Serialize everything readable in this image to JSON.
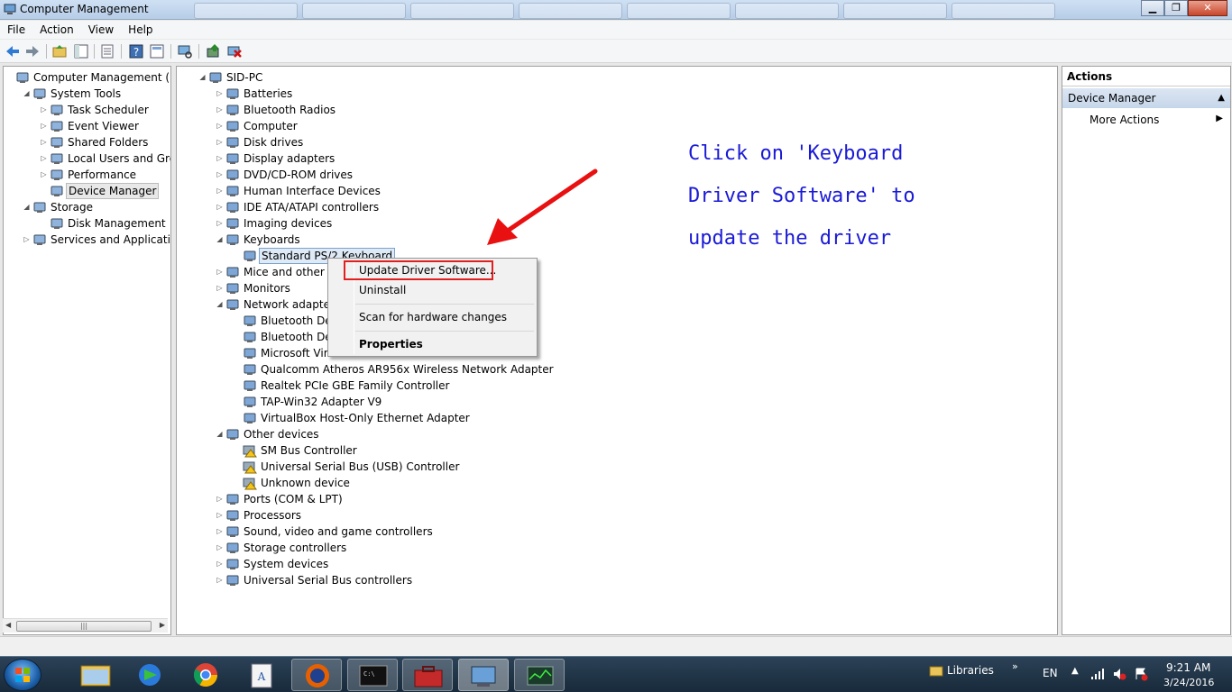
{
  "window": {
    "title": "Computer Management"
  },
  "menu": [
    "File",
    "Action",
    "View",
    "Help"
  ],
  "left_tree": [
    {
      "label": "Computer Management (Local",
      "level": 0,
      "expander": "",
      "icon": "computer-management-icon"
    },
    {
      "label": "System Tools",
      "level": 1,
      "expander": "◢",
      "icon": "system-tools-icon"
    },
    {
      "label": "Task Scheduler",
      "level": 2,
      "expander": "▷",
      "icon": "task-scheduler-icon"
    },
    {
      "label": "Event Viewer",
      "level": 2,
      "expander": "▷",
      "icon": "event-viewer-icon"
    },
    {
      "label": "Shared Folders",
      "level": 2,
      "expander": "▷",
      "icon": "shared-folders-icon"
    },
    {
      "label": "Local Users and Groups",
      "level": 2,
      "expander": "▷",
      "icon": "users-icon"
    },
    {
      "label": "Performance",
      "level": 2,
      "expander": "▷",
      "icon": "performance-icon"
    },
    {
      "label": "Device Manager",
      "level": 2,
      "expander": "",
      "icon": "device-manager-icon",
      "selected": true
    },
    {
      "label": "Storage",
      "level": 1,
      "expander": "◢",
      "icon": "storage-icon"
    },
    {
      "label": "Disk Management",
      "level": 2,
      "expander": "",
      "icon": "disk-management-icon"
    },
    {
      "label": "Services and Applications",
      "level": 1,
      "expander": "▷",
      "icon": "services-icon"
    }
  ],
  "device_tree": [
    {
      "label": "SID-PC",
      "level": 0,
      "expander": "◢",
      "icon": "computer-icon"
    },
    {
      "label": "Batteries",
      "level": 1,
      "expander": "▷",
      "icon": "battery-icon"
    },
    {
      "label": "Bluetooth Radios",
      "level": 1,
      "expander": "▷",
      "icon": "bluetooth-icon"
    },
    {
      "label": "Computer",
      "level": 1,
      "expander": "▷",
      "icon": "computer-icon"
    },
    {
      "label": "Disk drives",
      "level": 1,
      "expander": "▷",
      "icon": "disk-drive-icon"
    },
    {
      "label": "Display adapters",
      "level": 1,
      "expander": "▷",
      "icon": "display-adapter-icon"
    },
    {
      "label": "DVD/CD-ROM drives",
      "level": 1,
      "expander": "▷",
      "icon": "dvd-icon"
    },
    {
      "label": "Human Interface Devices",
      "level": 1,
      "expander": "▷",
      "icon": "hid-icon"
    },
    {
      "label": "IDE ATA/ATAPI controllers",
      "level": 1,
      "expander": "▷",
      "icon": "ide-icon"
    },
    {
      "label": "Imaging devices",
      "level": 1,
      "expander": "▷",
      "icon": "camera-icon"
    },
    {
      "label": "Keyboards",
      "level": 1,
      "expander": "◢",
      "icon": "keyboard-icon"
    },
    {
      "label": "Standard PS/2 Keyboard",
      "level": 2,
      "expander": "",
      "icon": "keyboard-icon",
      "focused": true
    },
    {
      "label": "Mice and other poin",
      "level": 1,
      "expander": "▷",
      "icon": "mouse-icon"
    },
    {
      "label": "Monitors",
      "level": 1,
      "expander": "▷",
      "icon": "monitor-icon"
    },
    {
      "label": "Network adapters",
      "level": 1,
      "expander": "◢",
      "icon": "network-icon"
    },
    {
      "label": "Bluetooth Device",
      "level": 2,
      "expander": "",
      "icon": "network-adapter-icon"
    },
    {
      "label": "Bluetooth Device",
      "level": 2,
      "expander": "",
      "icon": "network-adapter-icon"
    },
    {
      "label": "Microsoft Virtual",
      "level": 2,
      "expander": "",
      "icon": "network-adapter-icon"
    },
    {
      "label": "Qualcomm Atheros AR956x Wireless Network Adapter",
      "level": 2,
      "expander": "",
      "icon": "network-adapter-icon"
    },
    {
      "label": "Realtek PCIe GBE Family Controller",
      "level": 2,
      "expander": "",
      "icon": "network-adapter-icon"
    },
    {
      "label": "TAP-Win32 Adapter V9",
      "level": 2,
      "expander": "",
      "icon": "network-adapter-icon"
    },
    {
      "label": "VirtualBox Host-Only Ethernet Adapter",
      "level": 2,
      "expander": "",
      "icon": "network-adapter-icon"
    },
    {
      "label": "Other devices",
      "level": 1,
      "expander": "◢",
      "icon": "unknown-device-icon"
    },
    {
      "label": "SM Bus Controller",
      "level": 2,
      "expander": "",
      "icon": "warning-device-icon"
    },
    {
      "label": "Universal Serial Bus (USB) Controller",
      "level": 2,
      "expander": "",
      "icon": "warning-device-icon"
    },
    {
      "label": "Unknown device",
      "level": 2,
      "expander": "",
      "icon": "warning-device-icon"
    },
    {
      "label": "Ports (COM & LPT)",
      "level": 1,
      "expander": "▷",
      "icon": "port-icon"
    },
    {
      "label": "Processors",
      "level": 1,
      "expander": "▷",
      "icon": "processor-icon"
    },
    {
      "label": "Sound, video and game controllers",
      "level": 1,
      "expander": "▷",
      "icon": "sound-icon"
    },
    {
      "label": "Storage controllers",
      "level": 1,
      "expander": "▷",
      "icon": "storage-controller-icon"
    },
    {
      "label": "System devices",
      "level": 1,
      "expander": "▷",
      "icon": "system-device-icon"
    },
    {
      "label": "Universal Serial Bus controllers",
      "level": 1,
      "expander": "▷",
      "icon": "usb-icon"
    }
  ],
  "context_menu": {
    "update": "Update Driver Software...",
    "uninstall": "Uninstall",
    "scan": "Scan for hardware changes",
    "properties": "Properties"
  },
  "actions": {
    "header": "Actions",
    "section": "Device Manager",
    "more": "More Actions"
  },
  "annotation": {
    "line1": "Click on 'Keyboard",
    "line2": "Driver Software' to",
    "line3": "update the driver",
    "color": "#1a1ad6",
    "arrow_color": "#e81010"
  },
  "taskbar": {
    "libraries": "Libraries",
    "lang": "EN",
    "time": "9:21 AM",
    "date": "3/24/2016"
  },
  "colors": {
    "highlight_box": "#e02020",
    "actions_section": "#c6d6ea"
  }
}
